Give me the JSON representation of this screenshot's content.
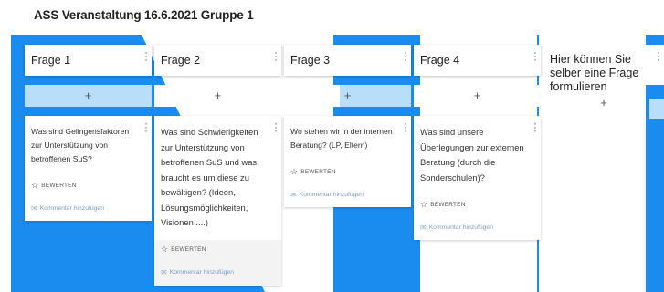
{
  "page": {
    "title": "ASS Veranstaltung 16.6.2021 Gruppe 1"
  },
  "colors": {
    "accent": "#1a8cf0",
    "add_bar": "#b9def9"
  },
  "columns": [
    {
      "title": "Frage 1",
      "add_label": "+",
      "card": {
        "text": "Was sind Gelingensfaktoren zur Unterstützung von betroffenen SuS?",
        "rate_label": "BEWERTEN",
        "comment_label": "Kommentar hinzufügen"
      }
    },
    {
      "title": "Frage 2",
      "add_label": "+",
      "card": {
        "text": "Was sind Schwierigkeiten zur Unterstützung von betroffenen SuS und was braucht es um diese zu bewältigen? (Ideen, Lösungsmöglichkeiten, Visionen ....)",
        "rate_label": "BEWERTEN",
        "comment_label": "Kommentar hinzufügen"
      }
    },
    {
      "title": "Frage 3",
      "add_label": "+",
      "card": {
        "text": "Wo stehen wir in der internen Beratung? (LP, Eltern)",
        "rate_label": "BEWERTEN",
        "comment_label": "Kommentar hinzufügen"
      }
    },
    {
      "title": "Frage 4",
      "add_label": "+",
      "card": {
        "text": "Was sind unsere Überlegungen zur externen Beratung (durch die Sonderschulen)?",
        "rate_label": "BEWERTEN",
        "comment_label": "Kommentar hinzufügen"
      }
    },
    {
      "title": "Hier können Sie selber eine Frage formulieren",
      "add_label": "+"
    }
  ],
  "icons": {
    "menu": "kebab-menu-icon",
    "star": "star-icon",
    "comment": "comment-icon"
  }
}
